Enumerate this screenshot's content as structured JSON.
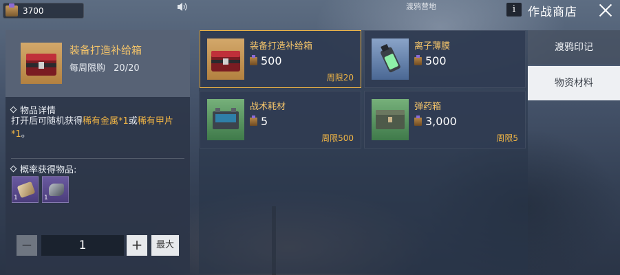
{
  "topbar": {
    "currency_value": "3700",
    "location": "渡鸦营地",
    "info_label": "i",
    "shop_title": "作战商店"
  },
  "detail": {
    "name": "装备打造补给箱",
    "limit_label": "每周限购",
    "limit_value": "20/20",
    "info_section_title": "物品详情",
    "desc_prefix": "打开后可随机获得",
    "desc_item1": "稀有金属*1",
    "desc_or": "或",
    "desc_item2": "稀有甲片*1",
    "desc_suffix": "。",
    "drops_section_title": "概率获得物品:",
    "drops": [
      {
        "count": "1",
        "icon": "rare-metal-icon"
      },
      {
        "count": "1",
        "icon": "rare-armor-plate-icon"
      }
    ],
    "quantity": "1",
    "minus_label": "−",
    "plus_label": "+",
    "max_label": "最大"
  },
  "products": [
    {
      "name": "装备打造补给箱",
      "price": "500",
      "limit": "周限20",
      "icon": "supply-crate-icon",
      "selected": true
    },
    {
      "name": "离子薄膜",
      "price": "500",
      "limit": "",
      "icon": "ion-film-canister-icon",
      "selected": false
    },
    {
      "name": "战术耗材",
      "price": "5",
      "limit": "周限500",
      "icon": "tactical-battery-icon",
      "selected": false
    },
    {
      "name": "弹药箱",
      "price": "3,000",
      "limit": "周限5",
      "icon": "ammo-box-icon",
      "selected": false
    }
  ],
  "tabs": [
    {
      "label": "渡鸦印记",
      "active": false
    },
    {
      "label": "物资材料",
      "active": true
    }
  ],
  "colors": {
    "accent": "#f0b545",
    "item_name": "#f4c46a",
    "panel": "#2c3648",
    "tab_active": "#eef0f3"
  }
}
